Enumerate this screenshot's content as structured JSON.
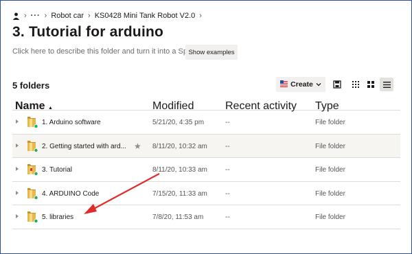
{
  "breadcrumb": {
    "items": [
      "Robot car",
      "KS0428 Mini Tank Robot V2.0"
    ]
  },
  "page": {
    "title": "3. Tutorial for arduino",
    "describe_text": "Click here to describe this folder and turn it into a Space",
    "show_examples_label": "Show examples",
    "folder_count": "5 folders"
  },
  "toolbar": {
    "create_label": "Create"
  },
  "table": {
    "headers": {
      "name": "Name",
      "modified": "Modified",
      "activity": "Recent activity",
      "type": "Type"
    },
    "rows": [
      {
        "name": "1. Arduino software",
        "modified": "5/21/20, 4:35 pm",
        "activity": "--",
        "type": "File folder",
        "icon": "shared-folder-icon"
      },
      {
        "name": "2. Getting started with ard...",
        "modified": "8/11/20, 10:32 am",
        "activity": "--",
        "type": "File folder",
        "icon": "shared-folder-icon"
      },
      {
        "name": "3. Tutorial",
        "modified": "8/11/20, 10:33 am",
        "activity": "--",
        "type": "File folder",
        "icon": "shared-folder-icon"
      },
      {
        "name": "4. ARDUINO Code",
        "modified": "7/15/20, 11:33 am",
        "activity": "--",
        "type": "File folder",
        "icon": "shared-folder-icon"
      },
      {
        "name": "5. libraries",
        "modified": "7/8/20, 11:53 am",
        "activity": "--",
        "type": "File folder",
        "icon": "shared-folder-icon"
      }
    ]
  },
  "colors": {
    "annotation_arrow": "#e02b2b",
    "folder": "#d9a93a",
    "sync_badge": "#1fae5b"
  }
}
